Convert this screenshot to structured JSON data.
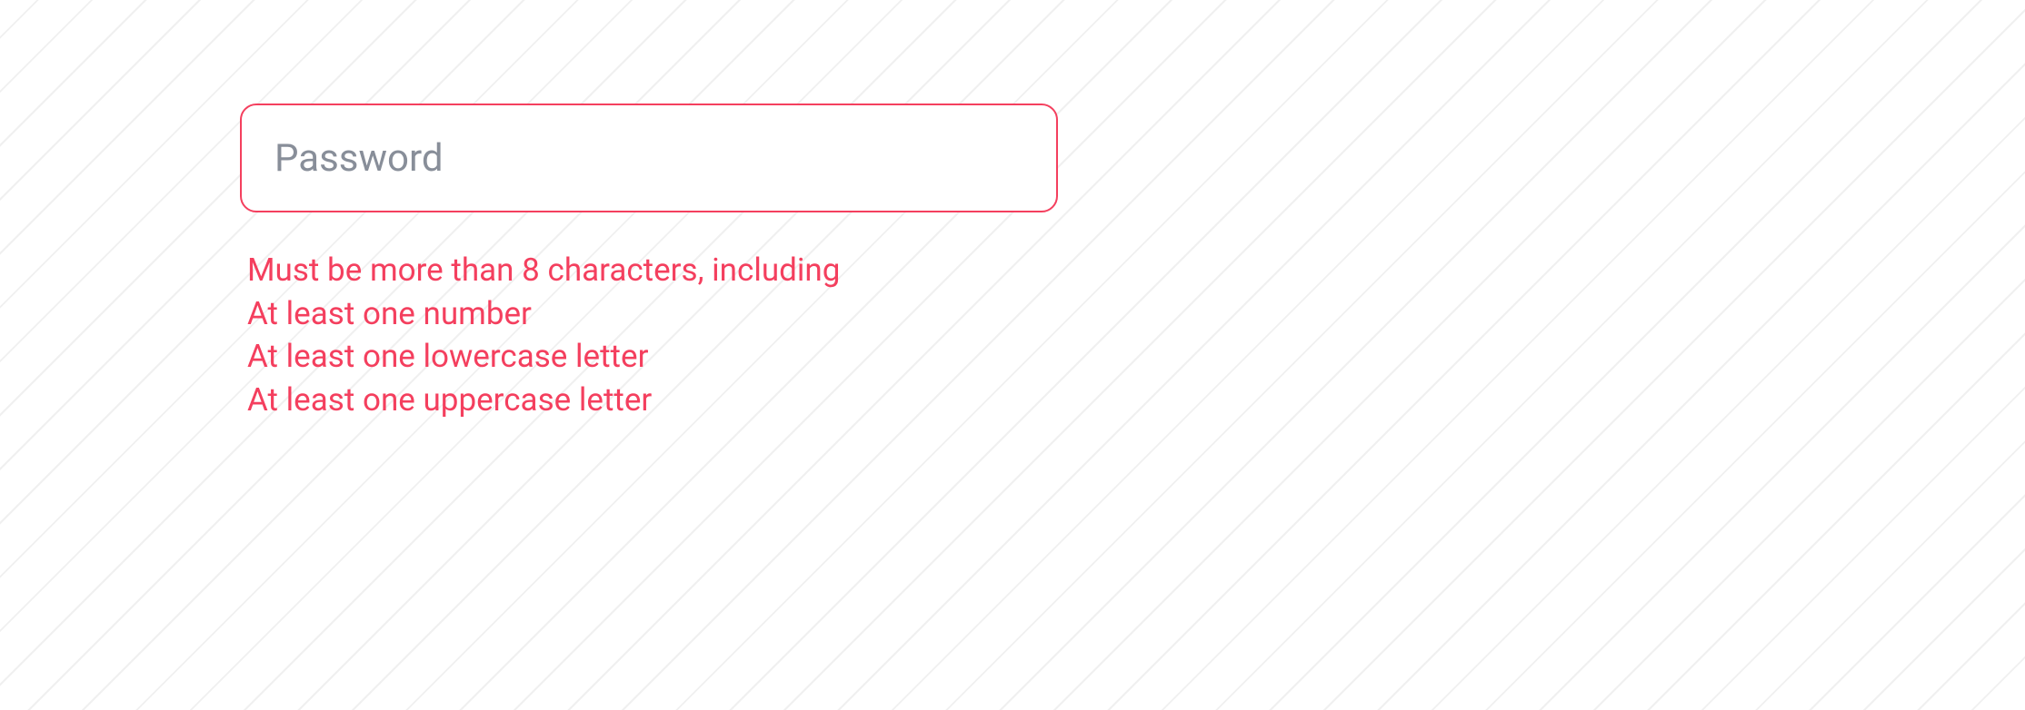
{
  "form": {
    "password": {
      "placeholder": "Password",
      "value": "",
      "errors": {
        "line1": "Must be more than 8 characters, including",
        "line2": "At least one number",
        "line3": "At least one lowercase letter",
        "line4": "At least one uppercase letter"
      }
    }
  },
  "colors": {
    "error": "#f43f5e",
    "placeholder": "#888e99"
  }
}
